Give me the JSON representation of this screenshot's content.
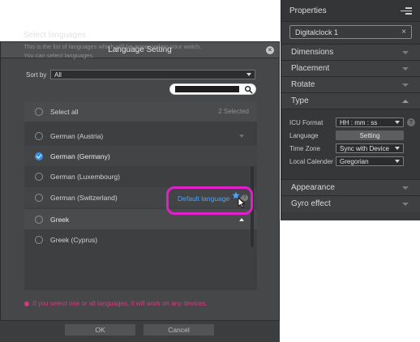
{
  "properties": {
    "title": "Properties",
    "object_name": "Digitalclock 1",
    "object_clear": "×",
    "sections": {
      "dimensions": "Dimensions",
      "placement": "Placement",
      "rotate": "Rotate",
      "type": "Type",
      "appearance": "Appearance",
      "gyro": "Gyro effect"
    },
    "type_fields": {
      "icu_label": "ICU Format",
      "icu_value": "HH : mm : ss",
      "language_label": "Language",
      "language_button": "Setting",
      "timezone_label": "Time Zone",
      "timezone_value": "Sync with Device",
      "calendar_label": "Local Calender",
      "calendar_value": "Gregorian",
      "help": "?"
    }
  },
  "dialog": {
    "title": "Language Setting",
    "close": "×",
    "heading": "Select languages",
    "description_line1": "This is the list of languages which will be appeared on your watch.",
    "description_line2": "You can select languages.",
    "sort_label": "Sort by",
    "sort_value": "All",
    "select_all": "Select all",
    "selected_count": "2 Selected",
    "languages": [
      {
        "label": "German (Austria)",
        "checked": false
      },
      {
        "label": "German (Germany)",
        "checked": true
      },
      {
        "label": "German (Luxembourg)",
        "checked": false
      },
      {
        "label": "German (Switzerland)",
        "checked": false
      },
      {
        "label": "Greek",
        "checked": false
      },
      {
        "label": "Greek (Cyprus)",
        "checked": false
      }
    ],
    "default_language": "Default language",
    "info": "?",
    "warning": "If you select one or all languages, it will work on any devices.",
    "ok": "OK",
    "cancel": "Cancel"
  },
  "colors": {
    "accent": "#3a8ee6",
    "default_link": "#4aa3ff",
    "highlight": "#e020c8",
    "warning": "#d23c7d"
  }
}
